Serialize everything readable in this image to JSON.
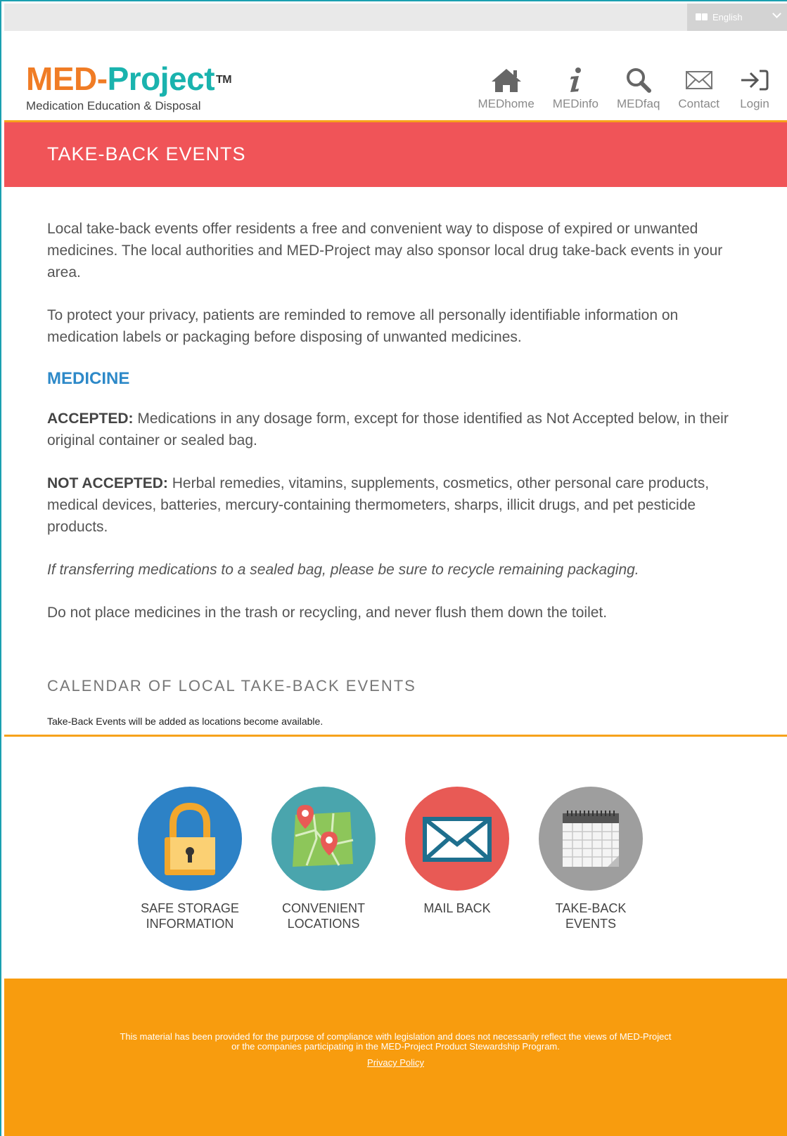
{
  "topbar": {
    "language_label": "English"
  },
  "header": {
    "logo": {
      "part1": "MED",
      "dash": "-",
      "part2": "Project",
      "tm": "TM"
    },
    "tagline": "Medication Education & Disposal",
    "nav": [
      {
        "label": "MEDhome",
        "icon": "home-icon"
      },
      {
        "label": "MEDinfo",
        "icon": "info-icon"
      },
      {
        "label": "MEDfaq",
        "icon": "search-icon"
      },
      {
        "label": "Contact",
        "icon": "envelope-icon"
      },
      {
        "label": "Login",
        "icon": "login-arrow-icon"
      }
    ]
  },
  "banner": {
    "title": "TAKE-BACK EVENTS"
  },
  "content": {
    "intro": "Local take-back events offer residents a free and convenient way to dispose of expired or unwanted medicines. The local authorities and MED-Project may also sponsor local drug take-back events in your area.",
    "privacy": "To protect your privacy, patients are reminded to remove all personally identifiable information on medication labels or packaging before disposing of unwanted medicines.",
    "medicine_heading": "MEDICINE",
    "accepted_label": "ACCEPTED:",
    "accepted_text": " Medications in any dosage form, except for those identified as Not Accepted below, in their original container or sealed bag.",
    "not_accepted_label": "NOT ACCEPTED:",
    "not_accepted_text": " Herbal remedies, vitamins, supplements, cosmetics, other personal care products, medical devices, batteries, mercury-containing thermometers, sharps, illicit drugs, and pet pesticide products.",
    "recycle_note": "If transferring medications to a sealed bag, please be sure to recycle remaining packaging.",
    "no_trash": "Do not place medicines in the trash or recycling, and never flush them down the toilet.",
    "calendar_title": "CALENDAR OF LOCAL TAKE-BACK EVENTS",
    "calendar_note": "Take-Back Events will be added as locations become available."
  },
  "quick_links": [
    {
      "line1": "SAFE STORAGE",
      "line2": "INFORMATION",
      "color": "#2d82c6",
      "icon": "padlock-icon"
    },
    {
      "line1": "CONVENIENT",
      "line2": "LOCATIONS",
      "color": "#4aa5ad",
      "icon": "map-pin-icon"
    },
    {
      "line1": "MAIL BACK",
      "line2": "",
      "color": "#e85a55",
      "icon": "mail-envelope-icon"
    },
    {
      "line1": "TAKE-BACK",
      "line2": "EVENTS",
      "color": "#9e9e9e",
      "icon": "calendar-icon"
    }
  ],
  "footer": {
    "disclaimer": "This material has been provided for the purpose of compliance with legislation and does not necessarily reflect the views of MED-Project or the companies participating in the MED-Project Product Stewardship Program.",
    "privacy_link": "Privacy Policy",
    "color": "#f89c0e"
  }
}
